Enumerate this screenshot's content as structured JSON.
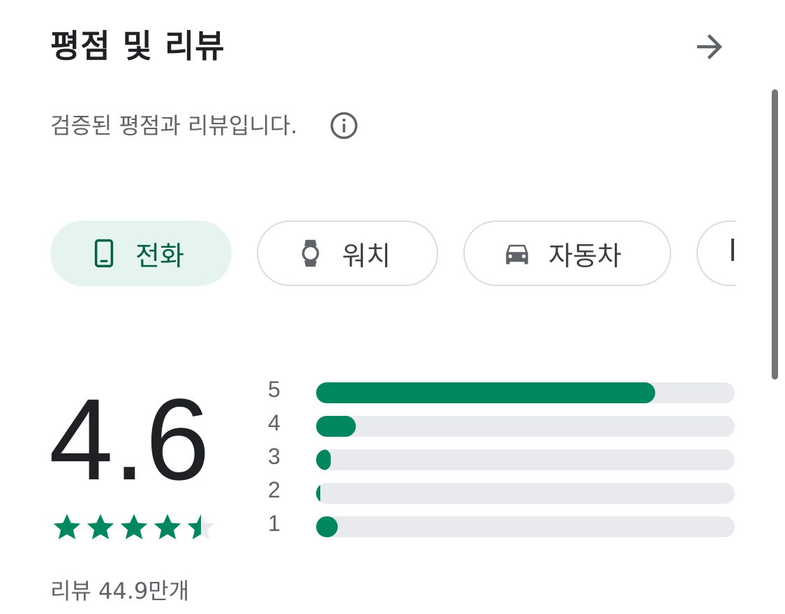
{
  "header": {
    "title": "평점 및 리뷰",
    "arrow_icon": "arrow-forward-icon"
  },
  "subtitle": {
    "text": "검증된 평점과 리뷰입니다.",
    "info_icon": "info-icon"
  },
  "device_chips": [
    {
      "label": "전화",
      "icon": "phone-icon",
      "selected": true
    },
    {
      "label": "워치",
      "icon": "watch-icon",
      "selected": false
    },
    {
      "label": "자동차",
      "icon": "car-icon",
      "selected": false
    },
    {
      "label": "",
      "icon": "",
      "selected": false
    }
  ],
  "rating": {
    "score": "4.6",
    "stars_filled": 4.6,
    "review_count": "리뷰 44.9만개"
  },
  "distribution": [
    {
      "label": "5",
      "fraction": 0.81
    },
    {
      "label": "4",
      "fraction": 0.095
    },
    {
      "label": "3",
      "fraction": 0.035
    },
    {
      "label": "2",
      "fraction": 0.01
    },
    {
      "label": "1",
      "fraction": 0.052
    }
  ],
  "colors": {
    "accent": "#01875f",
    "chip_selected_bg": "#e6f4ef",
    "chip_selected_text": "#01613f",
    "track": "#e8eaed"
  }
}
